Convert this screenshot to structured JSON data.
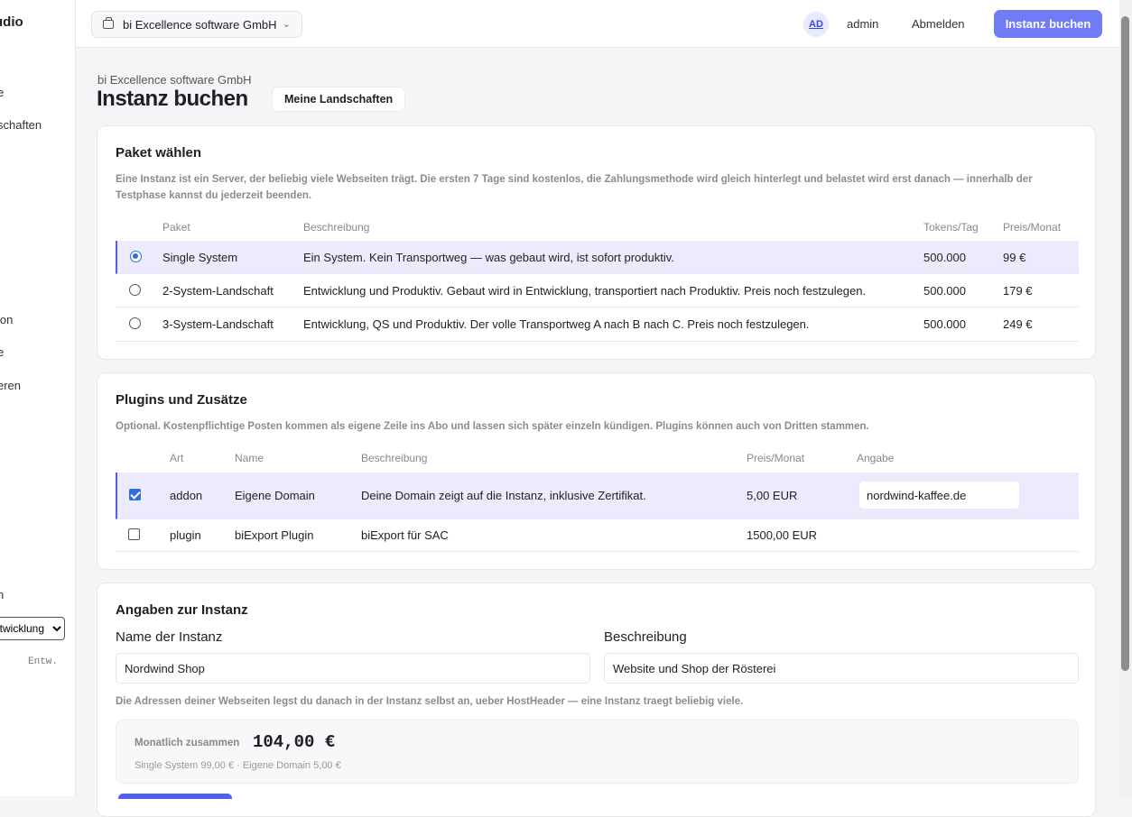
{
  "sidebar": {
    "brand": "udio",
    "items": [
      "e",
      "schaften",
      "ion",
      "e",
      "eren",
      "n"
    ],
    "env_select": "Entwicklung",
    "env_short": "Entw."
  },
  "topbar": {
    "org": "bi Excellence software GmbH",
    "avatar": "AD",
    "user": "admin",
    "logout": "Abmelden",
    "book": "Instanz buchen"
  },
  "page": {
    "breadcrumb": "bi Excellence software GmbH",
    "title": "Instanz buchen",
    "link": "Meine Landschaften"
  },
  "package": {
    "heading": "Paket wählen",
    "description": "Eine Instanz ist ein Server, der beliebig viele Webseiten trägt. Die ersten 7 Tage sind kostenlos, die Zahlungsmethode wird gleich hinterlegt und belastet wird erst danach — innerhalb der Testphase kannst du jederzeit beenden.",
    "headers": [
      "Paket",
      "Beschreibung",
      "Tokens/Tag",
      "Preis/Monat"
    ],
    "rows": [
      {
        "name": "Single System",
        "desc": "Ein System. Kein Transportweg — was gebaut wird, ist sofort produktiv.",
        "tokens": "500.000",
        "price": "99 €",
        "selected": true
      },
      {
        "name": "2-System-Landschaft",
        "desc": "Entwicklung und Produktiv. Gebaut wird in Entwicklung, transportiert nach Produktiv. Preis noch festzulegen.",
        "tokens": "500.000",
        "price": "179 €",
        "selected": false
      },
      {
        "name": "3-System-Landschaft",
        "desc": "Entwicklung, QS und Produktiv. Der volle Transportweg A nach B nach C. Preis noch festzulegen.",
        "tokens": "500.000",
        "price": "249 €",
        "selected": false
      }
    ]
  },
  "plugins": {
    "heading": "Plugins und Zusätze",
    "description": "Optional. Kostenpflichtige Posten kommen als eigene Zeile ins Abo und lassen sich später einzeln kündigen. Plugins können auch von Dritten stammen.",
    "headers": [
      "Art",
      "Name",
      "Beschreibung",
      "Preis/Monat",
      "Angabe"
    ],
    "rows": [
      {
        "type": "addon",
        "name": "Eigene Domain",
        "desc": "Deine Domain zeigt auf die Instanz, inklusive Zertifikat.",
        "price": "5,00 EUR",
        "input": "nordwind-kaffee.de",
        "checked": true
      },
      {
        "type": "plugin",
        "name": "biExport Plugin",
        "desc": "biExport für SAC",
        "price": "1500,00 EUR",
        "input": "",
        "checked": false
      }
    ]
  },
  "instance": {
    "heading": "Angaben zur Instanz",
    "name_label": "Name der Instanz",
    "name_value": "Nordwind Shop",
    "desc_label": "Beschreibung",
    "desc_value": "Website und Shop der Rösterei",
    "hint": "Die Adressen deiner Webseiten legst du danach in der Instanz selbst an, ueber HostHeader — eine Instanz traegt beliebig viele.",
    "total_label": "Monatlich zusammen",
    "total_value": "104,00 €",
    "breakdown": "Single System 99,00 € · Eigene Domain 5,00 €"
  },
  "colors": {
    "accent": "#6f7cf6",
    "selected_row": "#ecebfd",
    "radio": "#2d6fe0"
  }
}
